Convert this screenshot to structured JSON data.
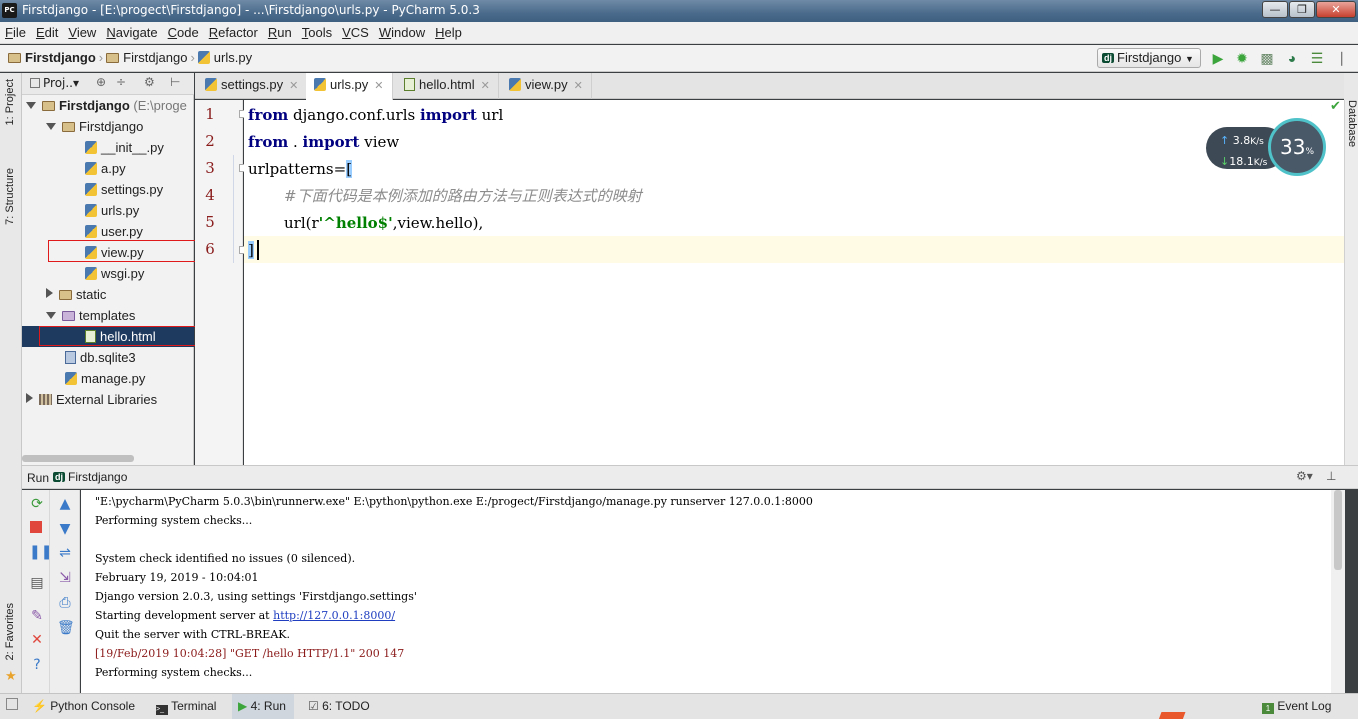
{
  "window": {
    "title": "Firstdjango - [E:\\progect\\Firstdjango] - ...\\Firstdjango\\urls.py - PyCharm 5.0.3",
    "app_icon_text": "PC",
    "minimize": "—",
    "maximize": "❐",
    "close": "✕"
  },
  "menu": [
    "File",
    "Edit",
    "View",
    "Navigate",
    "Code",
    "Refactor",
    "Run",
    "Tools",
    "VCS",
    "Window",
    "Help"
  ],
  "breadcrumb": [
    "Firstdjango",
    "Firstdjango",
    "urls.py"
  ],
  "run_config": "Firstdjango",
  "left_strip": {
    "project": "1: Project",
    "structure": "7: Structure",
    "favorites": "2: Favorites"
  },
  "project_panel": {
    "dropdown": "Proj..▾",
    "tree": [
      {
        "label": "Firstdjango",
        "suffix": "(E:\\proge"
      },
      {
        "label": "Firstdjango"
      },
      {
        "label": "__init__.py"
      },
      {
        "label": "a.py"
      },
      {
        "label": "settings.py"
      },
      {
        "label": "urls.py"
      },
      {
        "label": "user.py"
      },
      {
        "label": "view.py"
      },
      {
        "label": "wsgi.py"
      },
      {
        "label": "static"
      },
      {
        "label": "templates"
      },
      {
        "label": "hello.html"
      },
      {
        "label": "db.sqlite3"
      },
      {
        "label": "manage.py"
      },
      {
        "label": "External Libraries"
      }
    ]
  },
  "tabs": [
    {
      "label": "settings.py",
      "active": false
    },
    {
      "label": "urls.py",
      "active": true
    },
    {
      "label": "hello.html",
      "active": false
    },
    {
      "label": "view.py",
      "active": false
    }
  ],
  "editor": {
    "line_numbers": [
      "1",
      "2",
      "3",
      "4",
      "5",
      "6"
    ],
    "lines": {
      "l1": {
        "kw1": "from",
        "mid": " django.conf.urls ",
        "kw2": "import",
        "end": " url"
      },
      "l2": {
        "kw1": "from",
        "mid": " . ",
        "kw2": "import",
        "end": " view"
      },
      "l3": {
        "text": "urlpatterns=",
        "bracket": "["
      },
      "l4": {
        "comment": "#下面代码是本例添加的路由方法与正则表达式的映射"
      },
      "l5": {
        "a": "url(r",
        "str": "'^hello$'",
        "b": ",view.hello),"
      },
      "l6": {
        "bracket": "]"
      }
    }
  },
  "right_strip": {
    "database": "Database"
  },
  "network_widget": {
    "up": "3.8",
    "down": "18.1",
    "unit": "K/s",
    "percent": "33",
    "percent_unit": "%"
  },
  "run_panel": {
    "title": "Run",
    "config": "Firstdjango",
    "console": [
      "\"E:\\pycharm\\PyCharm 5.0.3\\bin\\runnerw.exe\" E:\\python\\python.exe E:/progect/Firstdjango/manage.py runserver 127.0.0.1:8000",
      "Performing system checks...",
      "",
      "System check identified no issues (0 silenced).",
      "February 19, 2019 - 10:04:01",
      "Django version 2.0.3, using settings 'Firstdjango.settings'",
      "Starting development server at ",
      "Quit the server with CTRL-BREAK.",
      "[19/Feb/2019 10:04:28] \"GET /hello HTTP/1.1\" 200 147",
      "Performing system checks..."
    ],
    "server_link": "http://127.0.0.1:8000/"
  },
  "status_bar": {
    "python_console": "Python Console",
    "terminal": "Terminal",
    "run": "4: Run",
    "todo": "6: TODO",
    "event_log": "Event Log",
    "event_count": "1"
  }
}
